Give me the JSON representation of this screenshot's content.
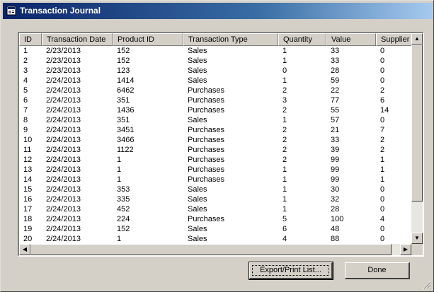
{
  "window": {
    "title": "Transaction Journal",
    "icon": "app-icon"
  },
  "table": {
    "columns": [
      "ID",
      "Transaction Date",
      "Product ID",
      "Transaction Type",
      "Quantity",
      "Value",
      "Supplier ID"
    ],
    "rows": [
      [
        "1",
        "2/23/2013",
        "152",
        "Sales",
        "1",
        "33",
        "0"
      ],
      [
        "2",
        "2/23/2013",
        "152",
        "Sales",
        "1",
        "33",
        "0"
      ],
      [
        "3",
        "2/23/2013",
        "123",
        "Sales",
        "0",
        "28",
        "0"
      ],
      [
        "4",
        "2/24/2013",
        "1414",
        "Sales",
        "1",
        "59",
        "0"
      ],
      [
        "5",
        "2/24/2013",
        "6462",
        "Purchases",
        "2",
        "22",
        "2"
      ],
      [
        "6",
        "2/24/2013",
        "351",
        "Purchases",
        "3",
        "77",
        "6"
      ],
      [
        "7",
        "2/24/2013",
        "1436",
        "Purchases",
        "2",
        "55",
        "14"
      ],
      [
        "8",
        "2/24/2013",
        "351",
        "Sales",
        "1",
        "57",
        "0"
      ],
      [
        "9",
        "2/24/2013",
        "3451",
        "Purchases",
        "2",
        "21",
        "7"
      ],
      [
        "10",
        "2/24/2013",
        "3466",
        "Purchases",
        "2",
        "33",
        "2"
      ],
      [
        "11",
        "2/24/2013",
        "1122",
        "Purchases",
        "2",
        "39",
        "2"
      ],
      [
        "12",
        "2/24/2013",
        "1",
        "Purchases",
        "2",
        "99",
        "1"
      ],
      [
        "13",
        "2/24/2013",
        "1",
        "Purchases",
        "1",
        "99",
        "1"
      ],
      [
        "14",
        "2/24/2013",
        "1",
        "Purchases",
        "1",
        "99",
        "1"
      ],
      [
        "15",
        "2/24/2013",
        "353",
        "Sales",
        "1",
        "30",
        "0"
      ],
      [
        "16",
        "2/24/2013",
        "335",
        "Sales",
        "1",
        "32",
        "0"
      ],
      [
        "17",
        "2/24/2013",
        "452",
        "Sales",
        "1",
        "28",
        "0"
      ],
      [
        "18",
        "2/24/2013",
        "224",
        "Purchases",
        "5",
        "100",
        "4"
      ],
      [
        "19",
        "2/24/2013",
        "152",
        "Sales",
        "6",
        "48",
        "0"
      ],
      [
        "20",
        "2/24/2013",
        "1",
        "Sales",
        "4",
        "88",
        "0"
      ]
    ]
  },
  "buttons": {
    "export": "Export/Print List...",
    "done": "Done"
  },
  "scrollbars": {
    "up": "▲",
    "down": "▼",
    "left": "◀",
    "right": "▶"
  }
}
